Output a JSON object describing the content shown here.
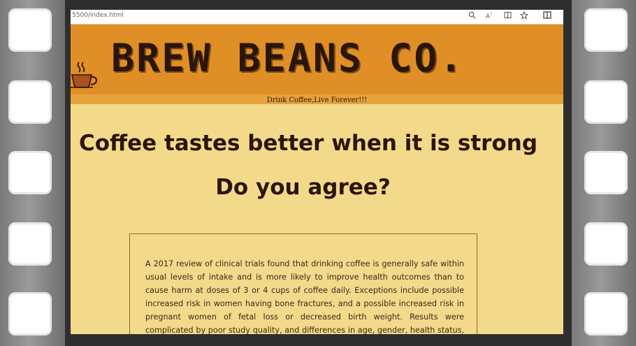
{
  "browser": {
    "url": "5500/index.html",
    "tools": [
      "search-icon",
      "read-aloud-icon",
      "immersive-reader-icon",
      "favorite-icon",
      "split-screen-icon"
    ]
  },
  "header": {
    "brand": "BREW BEANS CO.",
    "tagline": "Drink Coffee,Live Forever!!!"
  },
  "main": {
    "headline_prefix": "Coffee tastes better when it is ",
    "headline_strong": "strong",
    "question": "Do you agree?",
    "info_paragraph": "A 2017 review of clinical trials found that drinking coffee is generally safe within usual levels of intake and is more likely to improve health outcomes than to cause harm at doses of 3 or 4 cups of coffee daily. Exceptions include possible increased risk in women having bone fractures, and a possible increased risk in pregnant women of fetal loss or decreased birth weight. Results were complicated by poor study quality, and differences in age, gender, health status, and serving size."
  },
  "colors": {
    "header_bg": "#e08e26",
    "page_bg": "#f3d98a",
    "text": "#2a1608"
  }
}
